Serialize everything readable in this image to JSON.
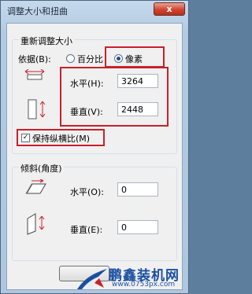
{
  "window": {
    "title": "调整大小和扭曲",
    "close_label": "x"
  },
  "resize": {
    "legend": "重新调整大小",
    "by_label": "依据(B):",
    "percent_label": "百分比",
    "pixels_label": "像素",
    "selected": "pixels",
    "horizontal_label": "水平(H):",
    "horizontal_value": "3264",
    "vertical_label": "垂直(V):",
    "vertical_value": "2448",
    "keep_ratio_label": "保持纵横比(M)",
    "keep_ratio_checked": true
  },
  "skew": {
    "legend": "倾斜(角度)",
    "horizontal_label": "水平(O):",
    "horizontal_value": "0",
    "vertical_label": "垂直(E):",
    "vertical_value": "0"
  },
  "watermark": {
    "brand": "鹏鑫装机网",
    "url": "www.0753px.com"
  },
  "colors": {
    "highlight": "#c8202a",
    "title_bg": "#c6d9ec",
    "brand": "#1a4fa0"
  }
}
